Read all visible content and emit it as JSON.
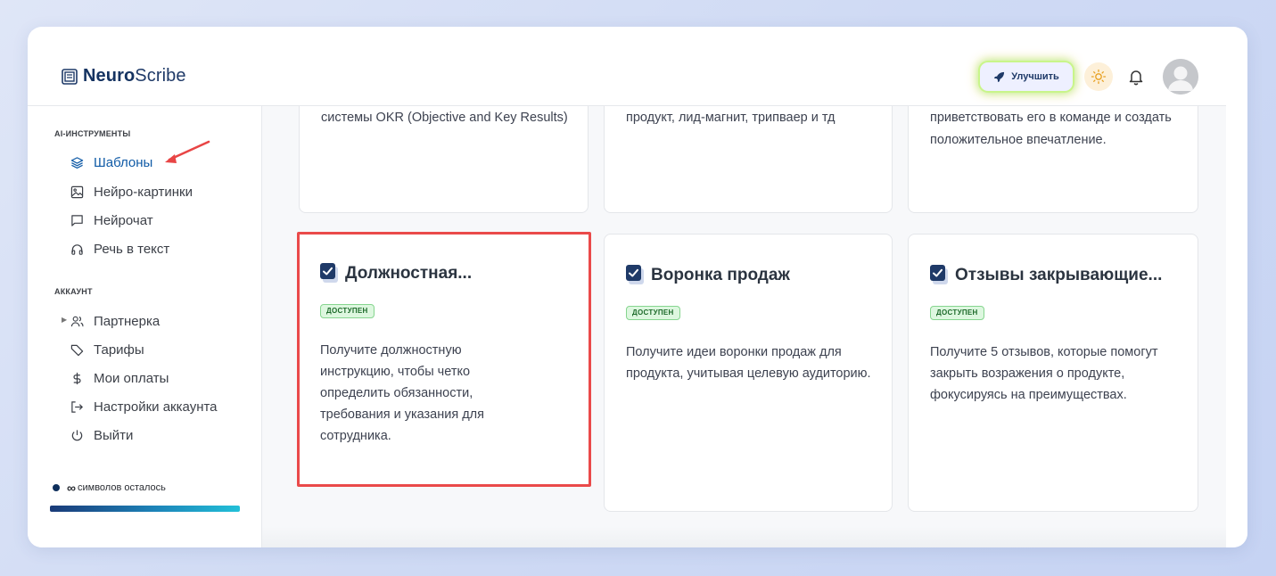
{
  "app": {
    "logo_bold": "Neuro",
    "logo_light": "Scribe"
  },
  "header": {
    "upgrade_label": "Улучшить"
  },
  "sidebar": {
    "ai_section": "AI-ИНСТРУМЕНТЫ",
    "ai_items": [
      {
        "label": "Шаблоны",
        "icon": "layers-icon",
        "active": true
      },
      {
        "label": "Нейро-картинки",
        "icon": "image-icon"
      },
      {
        "label": "Нейрочат",
        "icon": "chat-icon"
      },
      {
        "label": "Речь в текст",
        "icon": "headphones-icon"
      }
    ],
    "account_section": "АККАУНТ",
    "account_items": [
      {
        "label": "Партнерка",
        "icon": "users-icon"
      },
      {
        "label": "Тарифы",
        "icon": "tag-icon"
      },
      {
        "label": "Мои оплаты",
        "icon": "dollar-icon"
      },
      {
        "label": "Настройки аккаунта",
        "icon": "sign-in-icon"
      },
      {
        "label": "Выйти",
        "icon": "power-icon"
      }
    ],
    "credits_symbol": "∞",
    "credits_text": "символов осталось",
    "credits_fill_fraction": 1.0
  },
  "cards_top": [
    {
      "desc": "системы OKR (Objective and Key Results)"
    },
    {
      "desc": "продукт, лид-магнит, трипваер и тд"
    },
    {
      "desc": "приветствовать его в команде и создать положительное впечатление."
    }
  ],
  "cards": [
    {
      "title": "Должностная...",
      "badge": "ДОСТУПЕН",
      "desc": "Получите должностную инструкцию, чтобы четко определить обязанности, требования и указания для сотрудника."
    },
    {
      "title": "Воронка продаж",
      "badge": "ДОСТУПЕН",
      "desc": "Получите идеи воронки продаж для продукта, учитывая целевую аудиторию."
    },
    {
      "title": "Отзывы закрывающие...",
      "badge": "ДОСТУПЕН",
      "desc": "Получите 5 отзывов, которые помогут закрыть возражения о продукте, фокусируясь на преимуществах."
    }
  ],
  "colors": {
    "accent": "#0f5aa6",
    "brand": "#153361",
    "highlight": "#ea4a4a",
    "badge_bg": "#ddf7df"
  }
}
